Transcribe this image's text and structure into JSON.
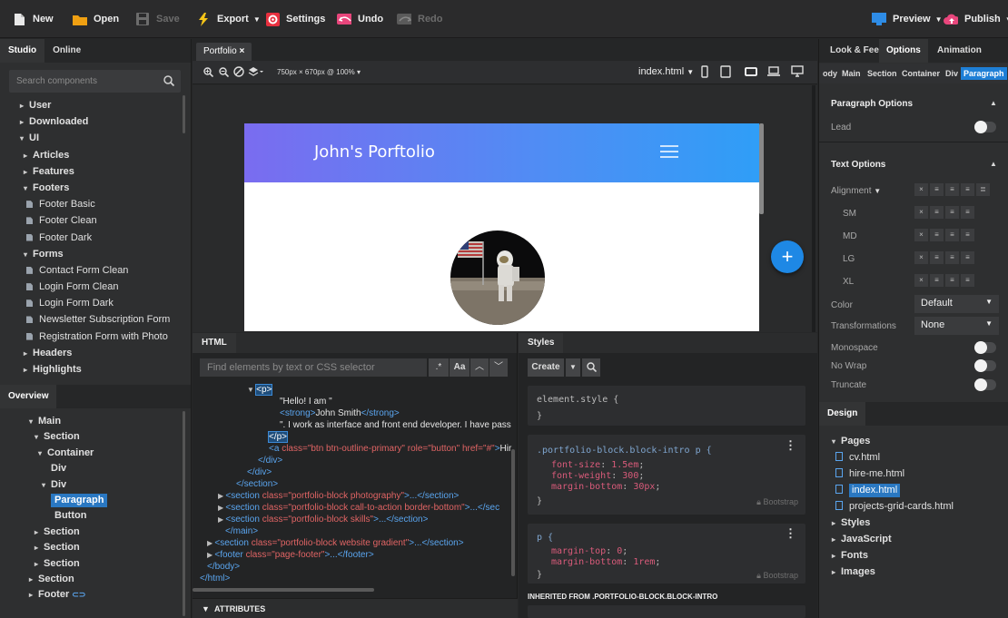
{
  "toolbar": {
    "new": "New",
    "open": "Open",
    "save": "Save",
    "export": "Export",
    "settings": "Settings",
    "undo": "Undo",
    "redo": "Redo",
    "preview": "Preview",
    "publish": "Publish"
  },
  "left": {
    "tabs": [
      "Studio",
      "Online"
    ],
    "search_placeholder": "Search components",
    "components": [
      {
        "label": "User",
        "expanded": false
      },
      {
        "label": "Downloaded",
        "expanded": false
      },
      {
        "label": "UI",
        "expanded": true
      },
      {
        "label": "Articles",
        "expanded": false
      },
      {
        "label": "Features",
        "expanded": false
      },
      {
        "label": "Footers",
        "expanded": true
      },
      {
        "label": "Footer Basic"
      },
      {
        "label": "Footer Clean"
      },
      {
        "label": "Footer Dark"
      },
      {
        "label": "Forms",
        "expanded": true
      },
      {
        "label": "Contact Form Clean"
      },
      {
        "label": "Login Form Clean"
      },
      {
        "label": "Login Form Dark"
      },
      {
        "label": "Newsletter Subscription Form"
      },
      {
        "label": "Registration Form with Photo"
      },
      {
        "label": "Headers",
        "expanded": false
      },
      {
        "label": "Highlights",
        "expanded": false
      }
    ],
    "overview_tab": "Overview",
    "overview": [
      {
        "label": "Main"
      },
      {
        "label": "Section"
      },
      {
        "label": "Container"
      },
      {
        "label": "Div"
      },
      {
        "label": "Div"
      },
      {
        "label": "Paragraph"
      },
      {
        "label": "Button"
      },
      {
        "label": "Section"
      },
      {
        "label": "Section"
      },
      {
        "label": "Section"
      },
      {
        "label": "Section"
      },
      {
        "label": "Footer"
      }
    ]
  },
  "center": {
    "doc_tab": "Portfolio",
    "viewport": "750px × 670px @ 100%",
    "page_select": "index.html",
    "page": {
      "title": "John's Porftolio"
    }
  },
  "html_panel": {
    "tab": "HTML",
    "find_placeholder": "Find elements by text or CSS selector",
    "case_btn": "Aa",
    "lines": [
      {
        "parts": [
          [
            "tg",
            "<p>"
          ]
        ],
        "hl": true
      },
      {
        "parts": [
          [
            "tx",
            "\"Hello! I am \""
          ]
        ]
      },
      {
        "parts": [
          [
            "tg",
            "<strong>"
          ],
          [
            "tx",
            "John Smith"
          ],
          [
            "tg",
            "</strong>"
          ]
        ]
      },
      {
        "parts": [
          [
            "tx",
            "\". I work as interface and front end developer. I have pass"
          ]
        ]
      },
      {
        "parts": [
          [
            "tg",
            "</p>"
          ]
        ],
        "hl": true
      },
      {
        "parts": [
          [
            "tg",
            "<a "
          ],
          [
            "at",
            "class="
          ],
          [
            "av",
            "\"btn btn-outline-primary\""
          ],
          [
            "at",
            " role="
          ],
          [
            "av",
            "\"button\""
          ],
          [
            "at",
            " href="
          ],
          [
            "av",
            "\"#\""
          ],
          [
            "tg",
            ">"
          ],
          [
            "tx",
            "Hir"
          ]
        ]
      },
      {
        "parts": [
          [
            "tg",
            "</div>"
          ]
        ]
      },
      {
        "parts": [
          [
            "tg",
            "</div>"
          ]
        ]
      },
      {
        "parts": [
          [
            "tg",
            "</section>"
          ]
        ]
      },
      {
        "parts": [
          [
            "tg",
            "<section "
          ],
          [
            "at",
            "class="
          ],
          [
            "av",
            "\"portfolio-block photography\""
          ],
          [
            "tg",
            ">...</section>"
          ]
        ]
      },
      {
        "parts": [
          [
            "tg",
            "<section "
          ],
          [
            "at",
            "class="
          ],
          [
            "av",
            "\"portfolio-block call-to-action border-bottom\""
          ],
          [
            "tg",
            ">...</sec"
          ]
        ]
      },
      {
        "parts": [
          [
            "tg",
            "<section "
          ],
          [
            "at",
            "class="
          ],
          [
            "av",
            "\"portfolio-block skills\""
          ],
          [
            "tg",
            ">...</section>"
          ]
        ]
      },
      {
        "parts": [
          [
            "tg",
            "</main>"
          ]
        ]
      },
      {
        "parts": [
          [
            "tg",
            "<section "
          ],
          [
            "at",
            "class="
          ],
          [
            "av",
            "\"portfolio-block website gradient\""
          ],
          [
            "tg",
            ">...</section>"
          ]
        ]
      },
      {
        "parts": [
          [
            "tg",
            "<footer "
          ],
          [
            "at",
            "class="
          ],
          [
            "av",
            "\"page-footer\""
          ],
          [
            "tg",
            ">...</footer>"
          ]
        ]
      },
      {
        "parts": [
          [
            "tg",
            "</body>"
          ]
        ]
      },
      {
        "parts": [
          [
            "tg",
            "</html>"
          ]
        ]
      }
    ],
    "attributes": "ATTRIBUTES"
  },
  "styles_panel": {
    "tab": "Styles",
    "create": "Create",
    "rules": [
      {
        "selector": "element.style {",
        "props": [],
        "close": "}"
      },
      {
        "selector": ".portfolio-block.block-intro p {",
        "props": [
          [
            "font-size",
            "1.5em"
          ],
          [
            "font-weight",
            "300"
          ],
          [
            "margin-bottom",
            "30px"
          ]
        ],
        "close": "}",
        "source": "Bootstrap"
      },
      {
        "selector": "p {",
        "props": [
          [
            "margin-top",
            "0"
          ],
          [
            "margin-bottom",
            "1rem"
          ]
        ],
        "close": "}",
        "source": "Bootstrap"
      }
    ],
    "inherited": "INHERITED FROM .PORTFOLIO-BLOCK.BLOCK-INTRO"
  },
  "right": {
    "tabs": [
      "Look & Feel",
      "Options",
      "Animation"
    ],
    "crumbs": [
      "ody",
      "Main",
      "Section",
      "Container",
      "Div",
      "Paragraph"
    ],
    "paragraph_options": "Paragraph Options",
    "lead": "Lead",
    "text_options": "Text Options",
    "alignment": "Alignment",
    "breakpoints": [
      "SM",
      "MD",
      "LG",
      "XL"
    ],
    "color_label": "Color",
    "color_value": "Default",
    "transform_label": "Transformations",
    "transform_value": "None",
    "monospace": "Monospace",
    "nowrap": "No Wrap",
    "truncate": "Truncate",
    "design_tab": "Design",
    "pages_label": "Pages",
    "pages": [
      "cv.html",
      "hire-me.html",
      "index.html",
      "projects-grid-cards.html"
    ],
    "folders": [
      "Styles",
      "JavaScript",
      "Fonts",
      "Images"
    ]
  }
}
